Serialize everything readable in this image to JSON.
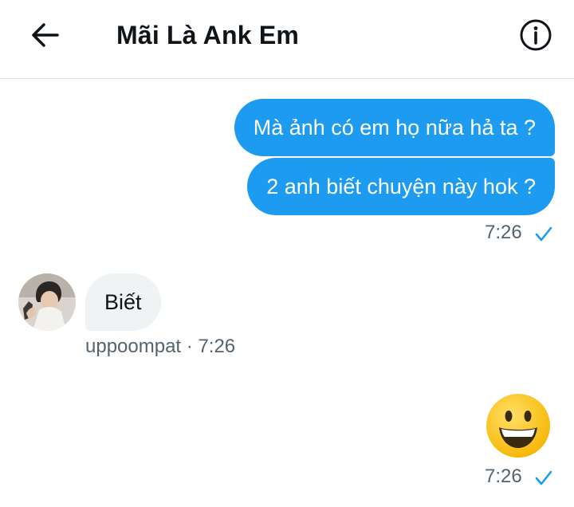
{
  "header": {
    "title": "Mãi Là Ank Em",
    "back_icon": "arrow-left-icon",
    "info_icon": "info-circle-icon"
  },
  "messages": {
    "outgoing_1": "Mà ảnh có em họ nữa hả ta ?",
    "outgoing_2": "2 anh biết chuyện này hok ?",
    "outgoing_time": "7:26",
    "incoming_text": "Biết",
    "incoming_sender": "uppoompat",
    "incoming_separator": "·",
    "incoming_time": "7:26",
    "emoji_icon": "grinning-face-emoji",
    "emoji_time": "7:26"
  },
  "colors": {
    "accent": "#1d9bf0",
    "incoming_bubble": "#eff3f4",
    "muted_text": "#536471",
    "emoji_yellow": "#ffcc33"
  }
}
